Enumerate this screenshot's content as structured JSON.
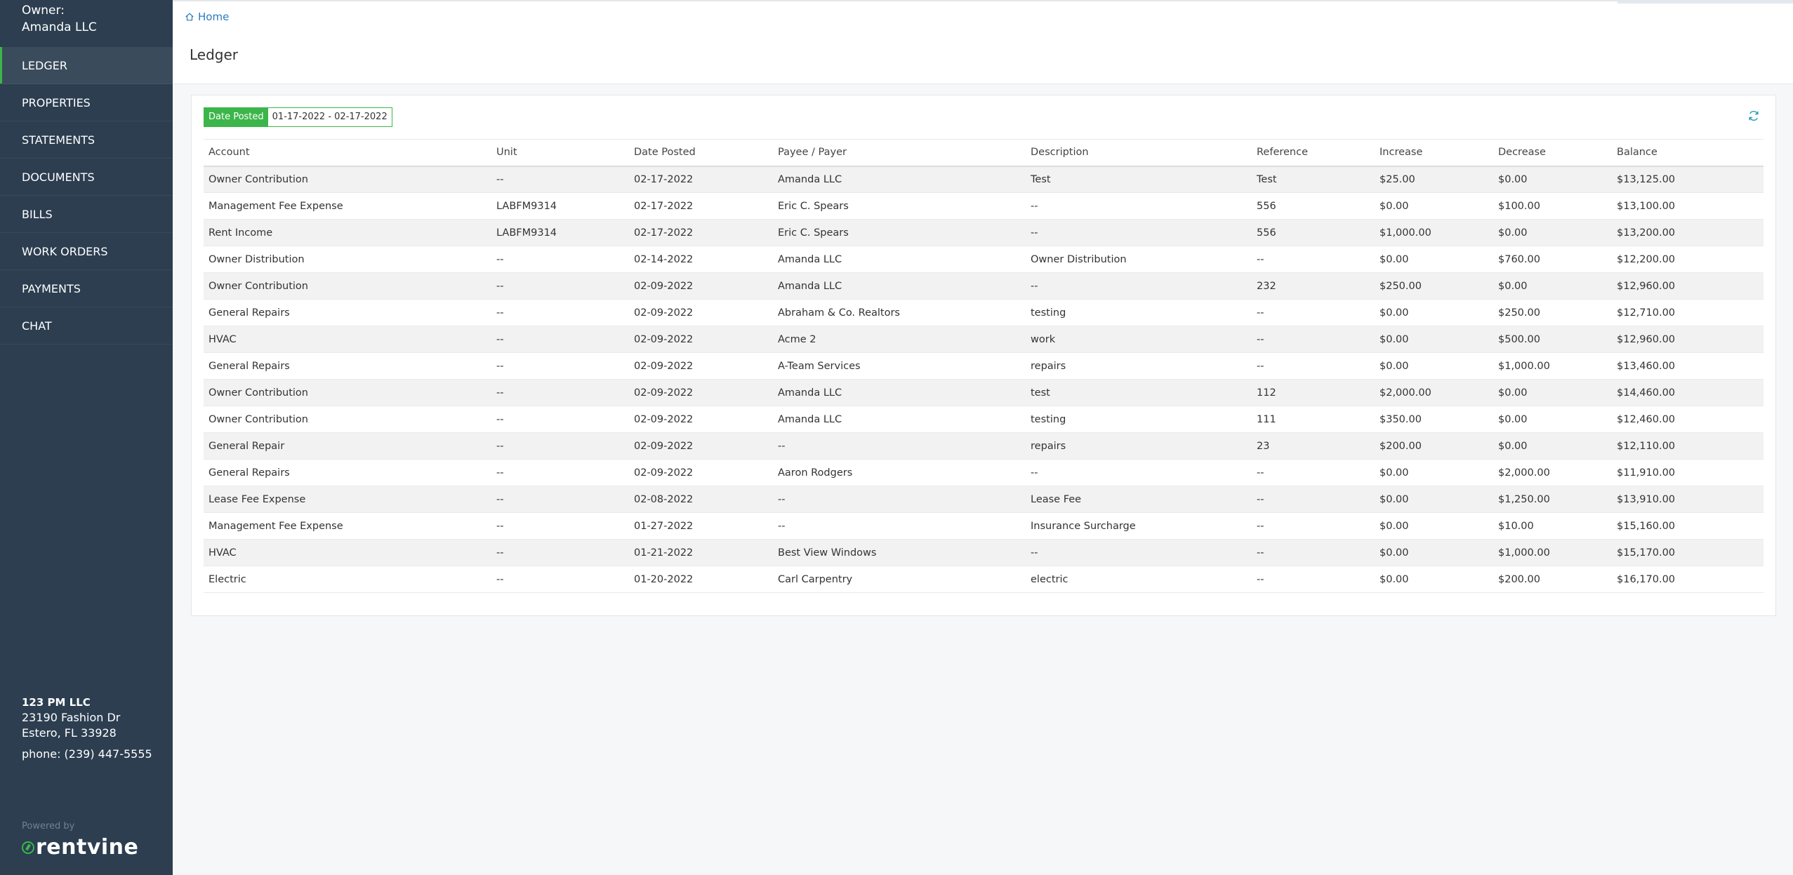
{
  "sidebar": {
    "owner_label": "Owner:",
    "owner_name": "Amanda LLC",
    "items": [
      {
        "label": "LEDGER"
      },
      {
        "label": "PROPERTIES"
      },
      {
        "label": "STATEMENTS"
      },
      {
        "label": "DOCUMENTS"
      },
      {
        "label": "BILLS"
      },
      {
        "label": "WORK ORDERS"
      },
      {
        "label": "PAYMENTS"
      },
      {
        "label": "CHAT"
      }
    ],
    "active_index": 0,
    "company": {
      "name": "123 PM LLC",
      "address1": "23190 Fashion Dr",
      "address2": "Estero, FL 33928",
      "phone": "phone: (239) 447-5555"
    },
    "powered_by": "Powered by",
    "logo_text": "rentvine"
  },
  "header": {
    "breadcrumb": "Home",
    "title": "Ledger"
  },
  "filter": {
    "label": "Date Posted",
    "value": "01-17-2022 - 02-17-2022"
  },
  "table": {
    "columns": [
      "Account",
      "Unit",
      "Date Posted",
      "Payee / Payer",
      "Description",
      "Reference",
      "Increase",
      "Decrease",
      "Balance"
    ],
    "rows": [
      [
        "Owner Contribution",
        "--",
        "02-17-2022",
        "Amanda LLC",
        "Test",
        "Test",
        "$25.00",
        "$0.00",
        "$13,125.00"
      ],
      [
        "Management Fee Expense",
        "LABFM9314",
        "02-17-2022",
        "Eric C. Spears",
        "--",
        "556",
        "$0.00",
        "$100.00",
        "$13,100.00"
      ],
      [
        "Rent Income",
        "LABFM9314",
        "02-17-2022",
        "Eric C. Spears",
        "--",
        "556",
        "$1,000.00",
        "$0.00",
        "$13,200.00"
      ],
      [
        "Owner Distribution",
        "--",
        "02-14-2022",
        "Amanda LLC",
        "Owner Distribution",
        "--",
        "$0.00",
        "$760.00",
        "$12,200.00"
      ],
      [
        "Owner Contribution",
        "--",
        "02-09-2022",
        "Amanda LLC",
        "--",
        "232",
        "$250.00",
        "$0.00",
        "$12,960.00"
      ],
      [
        "General Repairs",
        "--",
        "02-09-2022",
        "Abraham & Co. Realtors",
        "testing",
        "--",
        "$0.00",
        "$250.00",
        "$12,710.00"
      ],
      [
        "HVAC",
        "--",
        "02-09-2022",
        "Acme 2",
        "work",
        "--",
        "$0.00",
        "$500.00",
        "$12,960.00"
      ],
      [
        "General Repairs",
        "--",
        "02-09-2022",
        "A-Team Services",
        "repairs",
        "--",
        "$0.00",
        "$1,000.00",
        "$13,460.00"
      ],
      [
        "Owner Contribution",
        "--",
        "02-09-2022",
        "Amanda LLC",
        "test",
        "112",
        "$2,000.00",
        "$0.00",
        "$14,460.00"
      ],
      [
        "Owner Contribution",
        "--",
        "02-09-2022",
        "Amanda LLC",
        "testing",
        "111",
        "$350.00",
        "$0.00",
        "$12,460.00"
      ],
      [
        "General Repair",
        "--",
        "02-09-2022",
        "--",
        "repairs",
        "23",
        "$200.00",
        "$0.00",
        "$12,110.00"
      ],
      [
        "General Repairs",
        "--",
        "02-09-2022",
        "Aaron Rodgers",
        "--",
        "--",
        "$0.00",
        "$2,000.00",
        "$11,910.00"
      ],
      [
        "Lease Fee Expense",
        "--",
        "02-08-2022",
        "--",
        "Lease Fee",
        "--",
        "$0.00",
        "$1,250.00",
        "$13,910.00"
      ],
      [
        "Management Fee Expense",
        "--",
        "01-27-2022",
        "--",
        "Insurance Surcharge",
        "--",
        "$0.00",
        "$10.00",
        "$15,160.00"
      ],
      [
        "HVAC",
        "--",
        "01-21-2022",
        "Best View Windows",
        "--",
        "--",
        "$0.00",
        "$1,000.00",
        "$15,170.00"
      ],
      [
        "Electric",
        "--",
        "01-20-2022",
        "Carl Carpentry",
        "electric",
        "--",
        "$0.00",
        "$200.00",
        "$16,170.00"
      ]
    ]
  },
  "colors": {
    "sidebar_bg": "#2c3e50",
    "accent_green": "#3cb54a",
    "link_blue": "#2a7bbd"
  },
  "icons": {
    "breadcrumb": "home-icon",
    "refresh": "refresh-icon",
    "logo": "rentvine-leaf-icon"
  }
}
